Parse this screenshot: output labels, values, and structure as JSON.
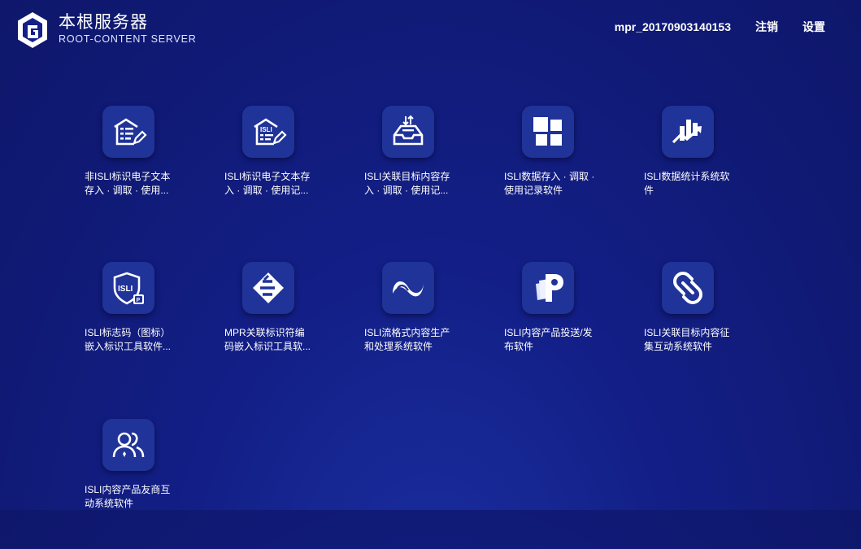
{
  "brand": {
    "name_cn": "本根服务器",
    "name_en": "ROOT-CONTENT SERVER"
  },
  "nav": {
    "username": "mpr_20170903140153",
    "logout": "注销",
    "settings": "设置"
  },
  "apps": [
    {
      "label_line1": "非ISLI标识电子文本",
      "label_line2": "存入 · 调取 · 使用...",
      "icon": "document-edit-icon"
    },
    {
      "label_line1": "ISLI标识电子文本存",
      "label_line2": "入 · 调取 · 使用记...",
      "icon": "isli-document-edit-icon"
    },
    {
      "label_line1": "ISLI关联目标内容存",
      "label_line2": "入 · 调取 · 使用记...",
      "icon": "inbox-tray-icon"
    },
    {
      "label_line1": "ISLI数据存入 · 调取 ·",
      "label_line2": "使用记录软件",
      "icon": "data-blocks-icon"
    },
    {
      "label_line1": "ISLI数据统计系统软",
      "label_line2": "件",
      "icon": "bar-chart-trend-icon"
    },
    {
      "label_line1": "ISLI标志码（图标）",
      "label_line2": "嵌入标识工具软件...",
      "icon": "isli-shield-icon"
    },
    {
      "label_line1": "MPR关联标识符编",
      "label_line2": "码嵌入标识工具软...",
      "icon": "mpr-layers-icon"
    },
    {
      "label_line1": "ISLI流格式内容生产",
      "label_line2": "和处理系统软件",
      "icon": "stream-wave-icon"
    },
    {
      "label_line1": "ISLI内容产品投送/发",
      "label_line2": "布软件",
      "icon": "publish-p-icon"
    },
    {
      "label_line1": "ISLI关联目标内容征",
      "label_line2": "集互动系统软件",
      "icon": "link-chain-icon"
    },
    {
      "label_line1": "ISLI内容产品友商互",
      "label_line2": "动系统软件",
      "icon": "partners-icon"
    }
  ]
}
